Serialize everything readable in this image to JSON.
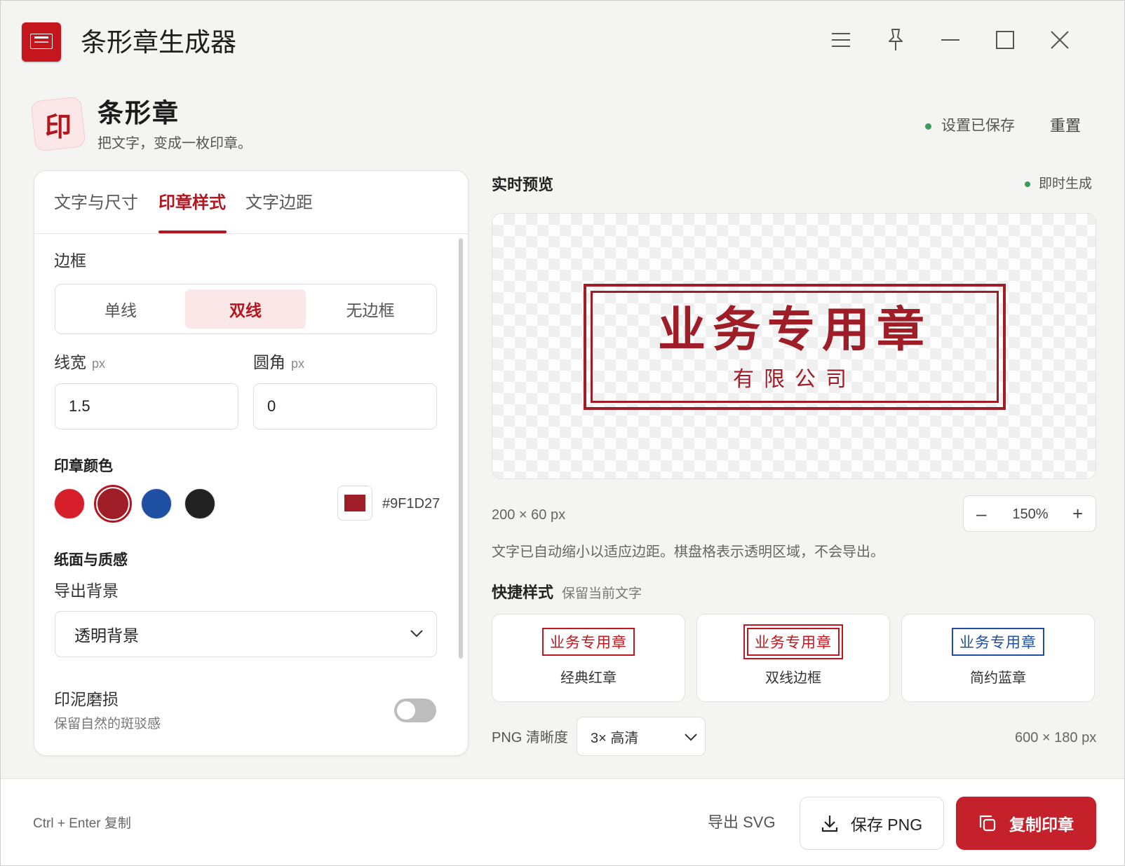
{
  "window": {
    "title": "条形章生成器",
    "controls": [
      "menu-icon",
      "pin-icon",
      "minimize-icon",
      "maximize-icon",
      "close-icon"
    ]
  },
  "header": {
    "icon_glyph": "印",
    "name": "条形章",
    "tagline": "把文字，变成一枚印章。",
    "status": "设置已保存",
    "reset": "重置"
  },
  "tabs": [
    {
      "label": "文字与尺寸",
      "active": false
    },
    {
      "label": "印章样式",
      "active": true
    },
    {
      "label": "文字边距",
      "active": false
    }
  ],
  "border": {
    "label": "边框",
    "options": [
      "单线",
      "双线",
      "无边框"
    ],
    "selected": "双线"
  },
  "line_width": {
    "label": "线宽",
    "unit": "px",
    "value": "1.5"
  },
  "radius": {
    "label": "圆角",
    "unit": "px",
    "value": "0"
  },
  "color": {
    "label": "印章颜色",
    "swatches": [
      "#D61F2A",
      "#9F1D27",
      "#1F4FA3",
      "#222222"
    ],
    "selected": "#9F1D27",
    "hex": "#9F1D27"
  },
  "paper": {
    "section": "纸面与质感",
    "bg_label": "导出背景",
    "bg_value": "透明背景",
    "wear_label": "印泥磨损",
    "wear_hint": "保留自然的斑驳感",
    "wear_on": false
  },
  "preview": {
    "title": "实时预览",
    "live": "即时生成",
    "main_text": "业务专用章",
    "sub_text": "有限公司",
    "size": "200 × 60 px",
    "zoom": "150%",
    "zoom_minus": "–",
    "zoom_plus": "+",
    "note": "文字已自动缩小以适应边距。棋盘格表示透明区域，不会导出。"
  },
  "quick": {
    "title": "快捷样式",
    "hint": "保留当前文字",
    "cards": [
      {
        "sample": "业务专用章",
        "name": "经典红章",
        "color": "#C4161C"
      },
      {
        "sample": "业务专用章",
        "name": "双线边框",
        "color": "#C4161C"
      },
      {
        "sample": "业务专用章",
        "name": "简约蓝章",
        "color": "#1F4FA3"
      }
    ]
  },
  "png": {
    "label": "PNG 清晰度",
    "value": "3× 高清",
    "size": "600 × 180 px"
  },
  "footer": {
    "shortcut": "Ctrl + Enter 复制",
    "export_svg": "导出 SVG",
    "save_png": "保存 PNG",
    "copy": "复制印章"
  }
}
